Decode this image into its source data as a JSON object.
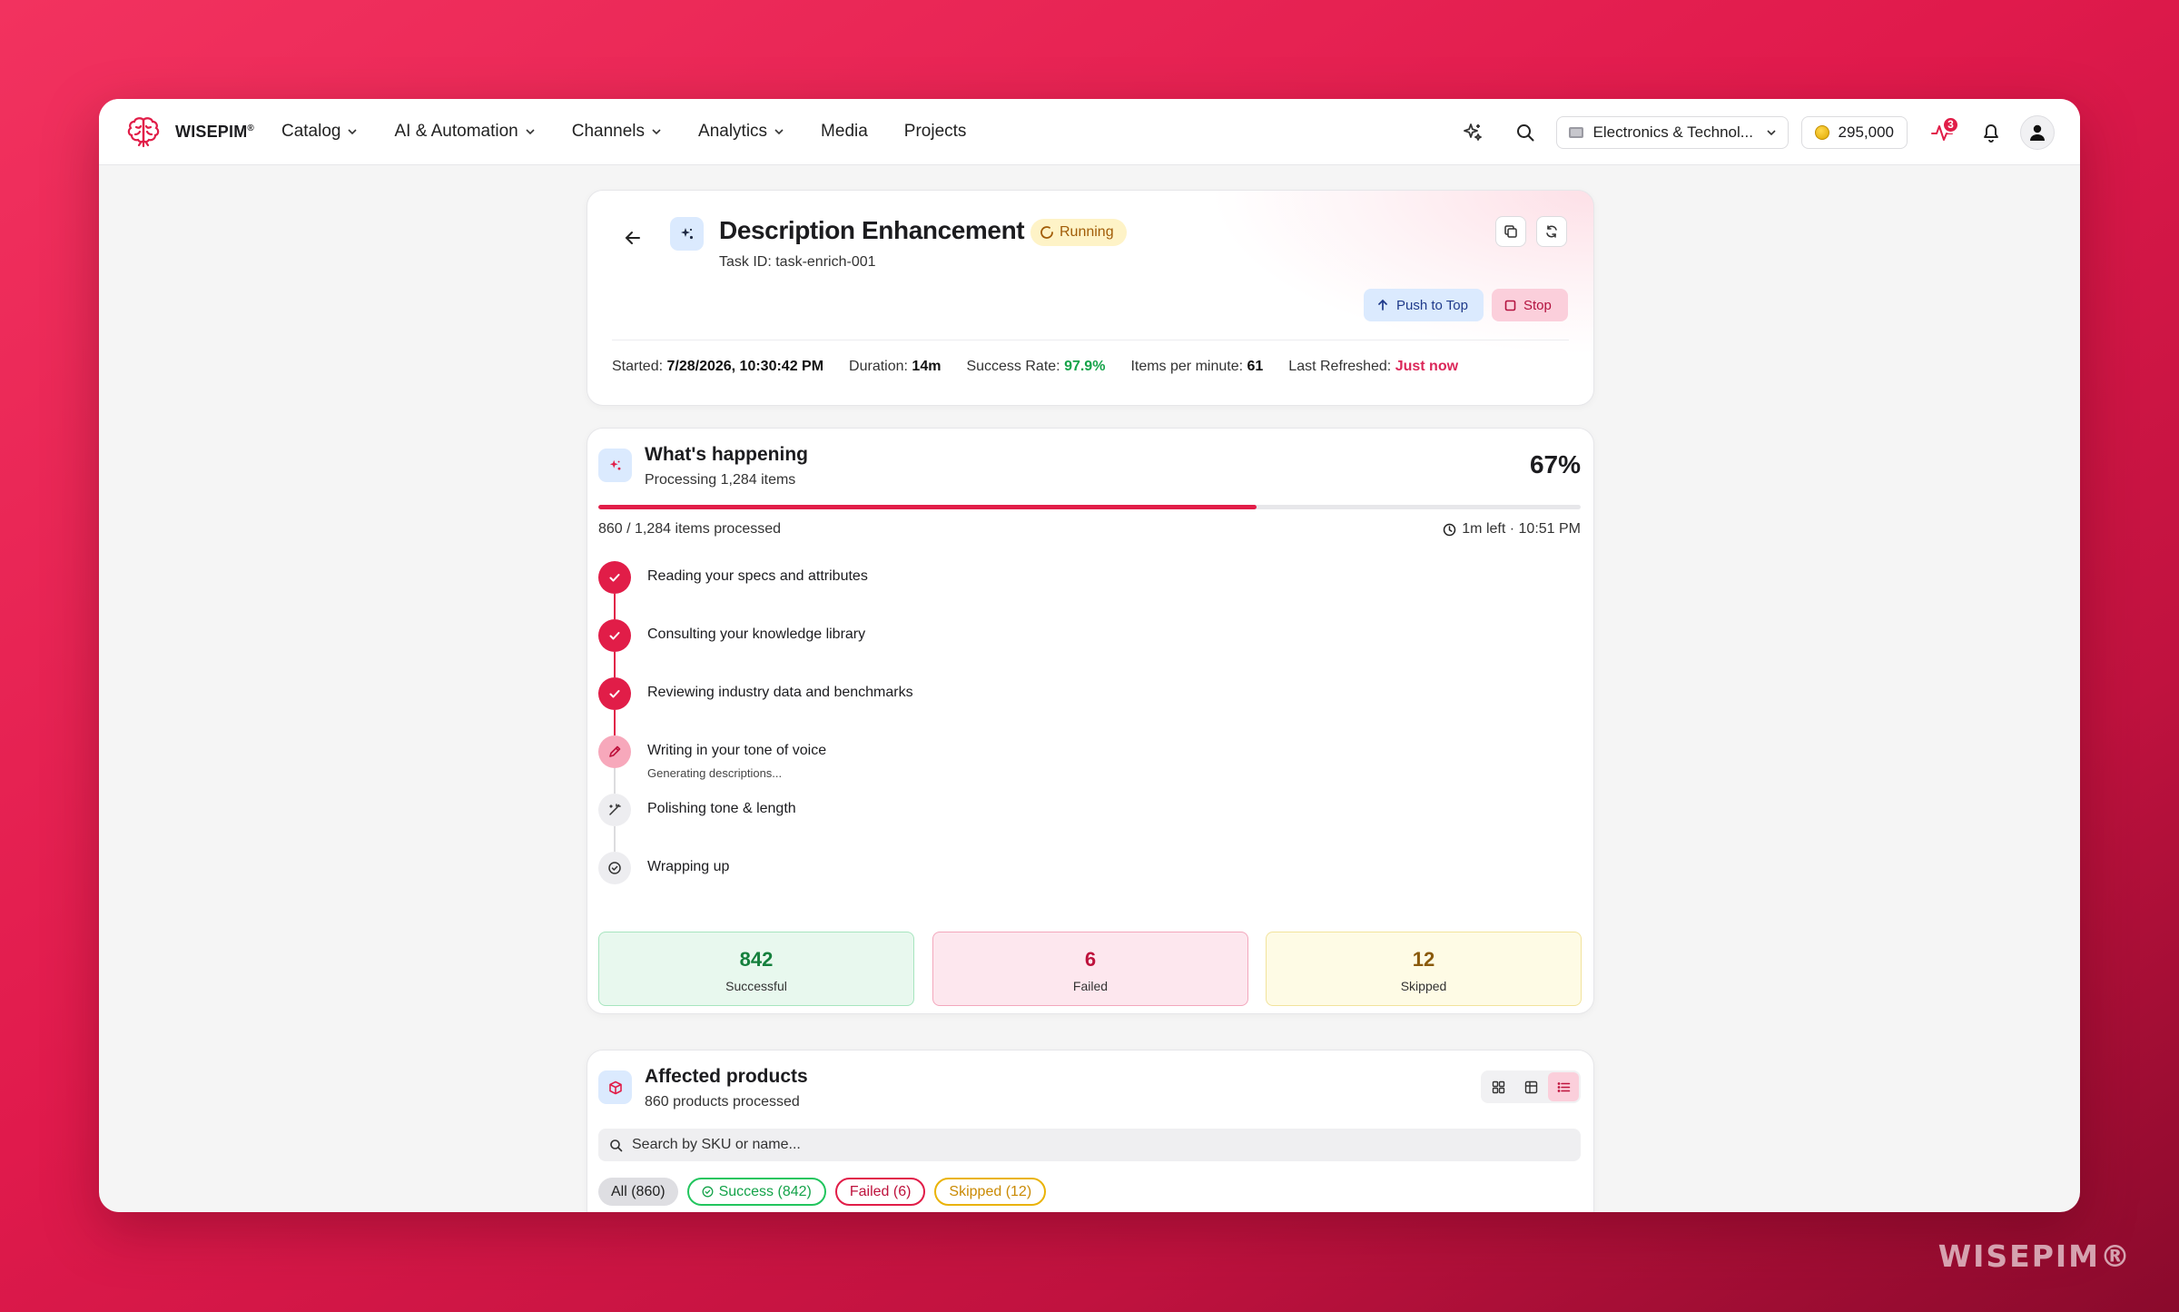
{
  "nav": {
    "brand": "WISEPIM",
    "brand_mark": "®",
    "items": [
      {
        "label": "Catalog",
        "dropdown": true
      },
      {
        "label": "AI & Automation",
        "dropdown": true
      },
      {
        "label": "Channels",
        "dropdown": true
      },
      {
        "label": "Analytics",
        "dropdown": true
      },
      {
        "label": "Media",
        "dropdown": false
      },
      {
        "label": "Projects",
        "dropdown": false
      }
    ],
    "workspace": "Electronics & Technol...",
    "credits": "295,000",
    "activity_badge": "3"
  },
  "task": {
    "title": "Description Enhancement",
    "status": "Running",
    "task_id": "Task ID: task-enrich-001",
    "push_label": "Push to Top",
    "stop_label": "Stop",
    "meta": {
      "started_label": "Started:",
      "started": "7/28/2026, 10:30:42 PM",
      "duration_label": "Duration:",
      "duration": "14m",
      "success_label": "Success Rate:",
      "success_rate": "97.9%",
      "ipm_label": "Items per minute:",
      "ipm": "61",
      "refreshed_label": "Last Refreshed:",
      "refreshed": "Just now"
    }
  },
  "progress": {
    "title": "What's happening",
    "subtitle": "Processing 1,284 items",
    "percent_label": "67%",
    "percent": 0.67,
    "processed": "860 / 1,284 items processed",
    "eta": "1m left · 10:51 PM",
    "steps": [
      {
        "label": "Reading your specs and attributes",
        "state": "done",
        "sub": ""
      },
      {
        "label": "Consulting your knowledge library",
        "state": "done",
        "sub": ""
      },
      {
        "label": "Reviewing industry data and benchmarks",
        "state": "done",
        "sub": ""
      },
      {
        "label": "Writing in your tone of voice",
        "state": "active",
        "sub": "Generating descriptions..."
      },
      {
        "label": "Polishing tone & length",
        "state": "pending",
        "sub": ""
      },
      {
        "label": "Wrapping up",
        "state": "pending",
        "sub": ""
      }
    ],
    "stats": {
      "successful": {
        "value": "842",
        "label": "Successful"
      },
      "failed": {
        "value": "6",
        "label": "Failed"
      },
      "skipped": {
        "value": "12",
        "label": "Skipped"
      }
    }
  },
  "products": {
    "title": "Affected products",
    "subtitle": "860 products processed",
    "search_placeholder": "Search by SKU or name...",
    "filters": {
      "all": "All (860)",
      "success": "Success (842)",
      "failed": "Failed (6)",
      "skipped": "Skipped (12)"
    }
  },
  "watermark": "WISEPIM®",
  "colors": {
    "accent": "#e11d48",
    "success": "#16a34a",
    "warning": "#eab308"
  }
}
